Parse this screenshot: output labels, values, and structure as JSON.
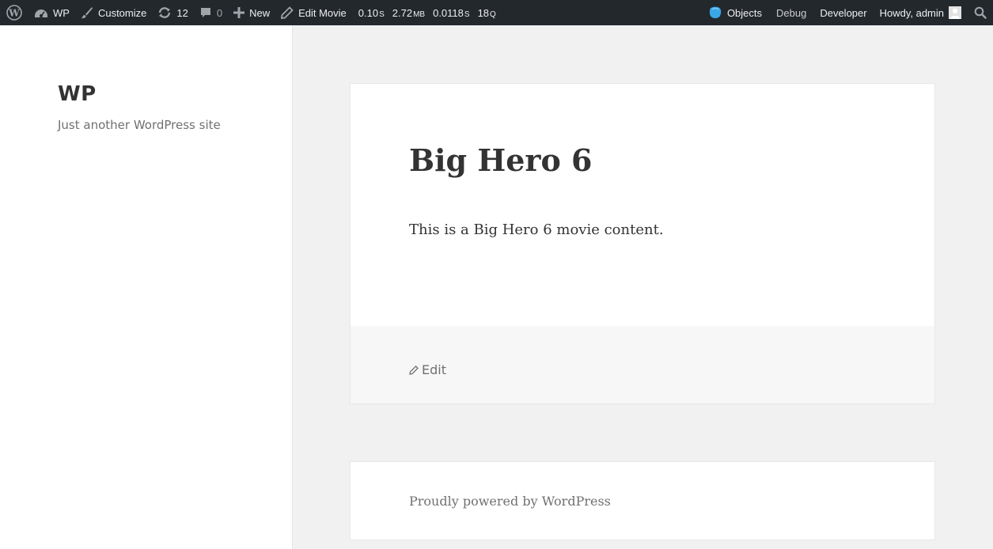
{
  "adminbar": {
    "wp_logo_icon": "wordpress-logo-icon",
    "site_name": "WP",
    "customize": "Customize",
    "updates_count": "12",
    "comments_count": "0",
    "new_label": "New",
    "edit_label": "Edit Movie",
    "qm": {
      "time": "0.10",
      "time_unit": "S",
      "memory": "2.72",
      "memory_unit": "MB",
      "db_time": "0.0118",
      "db_time_unit": "S",
      "queries": "18",
      "queries_unit": "Q"
    },
    "objects": "Objects",
    "debug": "Debug",
    "developer": "Developer",
    "howdy": "Howdy, admin"
  },
  "sidebar": {
    "site_title": "WP",
    "site_description": "Just another WordPress site"
  },
  "article": {
    "title": "Big Hero 6",
    "content": "This is a Big Hero 6 movie content.",
    "edit_label": "Edit"
  },
  "footer": {
    "powered_by": "Proudly powered by WordPress"
  },
  "colors": {
    "adminbar_bg": "#23282d",
    "page_bg": "#f1f1f1",
    "objects_icon": "#3aa7e6"
  }
}
